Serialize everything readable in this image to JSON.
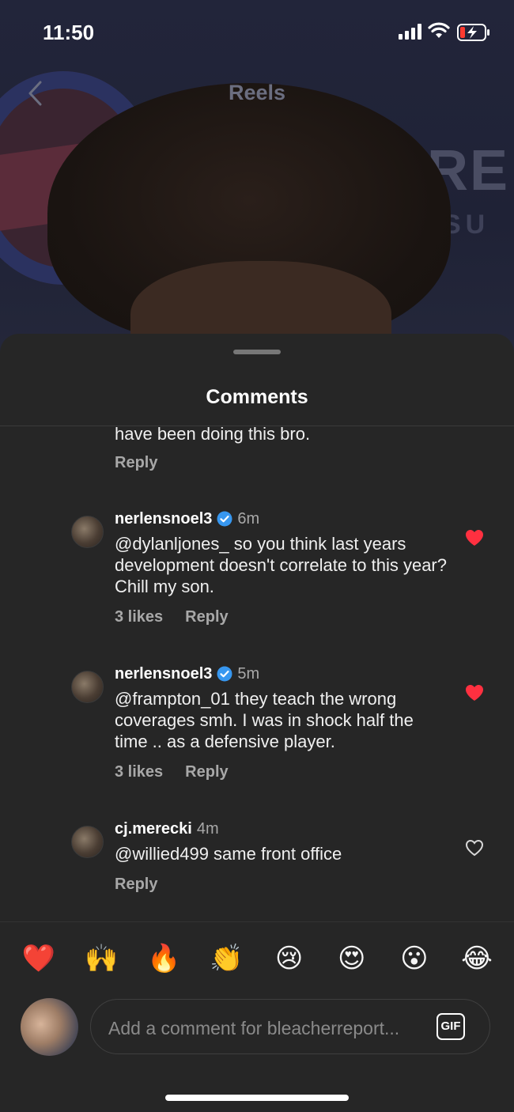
{
  "status_bar": {
    "time": "11:50"
  },
  "header": {
    "title": "Reels"
  },
  "sheet": {
    "title": "Comments"
  },
  "comments": [
    {
      "text": "have been doing this bro.",
      "reply_label": "Reply"
    },
    {
      "username": "nerlensnoel3",
      "verified": true,
      "time": "6m",
      "text": "@dylanljones_ so you think last years development doesn't correlate to this year? Chill my son.",
      "likes": "3 likes",
      "reply_label": "Reply",
      "liked": true
    },
    {
      "username": "nerlensnoel3",
      "verified": true,
      "time": "5m",
      "text": "@frampton_01 they teach the wrong coverages smh. I was in shock half the time .. as a defensive player.",
      "likes": "3 likes",
      "reply_label": "Reply",
      "liked": true
    },
    {
      "username": "cj.merecki",
      "verified": false,
      "time": "4m",
      "text": "@willied499 same front office",
      "reply_label": "Reply",
      "liked": false
    }
  ],
  "quick_reactions": [
    "❤️",
    "🙌",
    "🔥",
    "👏",
    "😢",
    "😍",
    "😮",
    "😂"
  ],
  "comment_input": {
    "placeholder": "Add a comment for bleacherreport...",
    "gif_label": "GIF"
  },
  "colors": {
    "like_red": "#ff3040",
    "verified_blue": "#3797f0",
    "sheet_bg": "#262626"
  }
}
